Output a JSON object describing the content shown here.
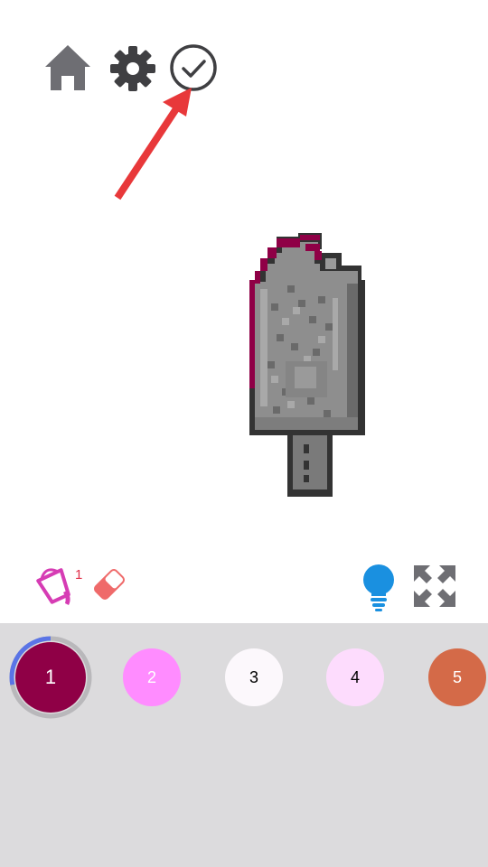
{
  "toolbar": {
    "home_icon": "home-icon",
    "settings_icon": "gear-icon",
    "done_icon": "check-circle-icon"
  },
  "tools": {
    "bucket_icon": "paint-bucket-icon",
    "bucket_count": "1",
    "eraser_icon": "eraser-icon",
    "hint_icon": "lightbulb-icon",
    "fit_icon": "expand-icon"
  },
  "palette": {
    "selected_progress": 0.28,
    "colors": [
      {
        "label": "1",
        "color": "#8f0046",
        "text_color": "#ffffff",
        "selected": true
      },
      {
        "label": "2",
        "color": "#ff8cff",
        "text_color": "#ffffff",
        "selected": false
      },
      {
        "label": "3",
        "color": "#fcf8fc",
        "text_color": "#000000",
        "selected": false
      },
      {
        "label": "4",
        "color": "#fddcfd",
        "text_color": "#000000",
        "selected": false
      },
      {
        "label": "5",
        "color": "#d46a48",
        "text_color": "#ffffff",
        "selected": false
      }
    ]
  },
  "colors": {
    "accent_arrow": "#e8383a",
    "icon_gray": "#6e6e73",
    "hint_blue": "#1a90e0",
    "bucket_magenta": "#d63cb4",
    "eraser_red": "#ef6a6a",
    "progress_blue": "#5a74e6"
  }
}
